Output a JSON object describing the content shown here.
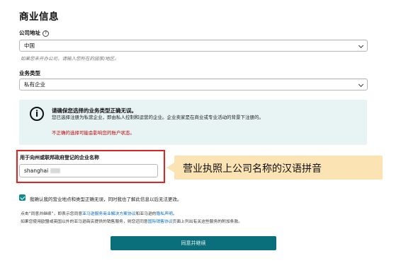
{
  "page": {
    "title": "商业信息"
  },
  "address": {
    "label": "公司地址",
    "help": "?",
    "value": "中国",
    "hint": "如果您未开办公司，请输入您所在的国家/地区。"
  },
  "business_type": {
    "label": "业务类型",
    "value": "私有企业"
  },
  "info": {
    "icon": "i",
    "title": "请确保您选择的业务类型正确无误。",
    "body": "您已选择注册为私营企业，即由私人控制和运营的企业。企业卖家是在商业或专业活动的背景下注册的。",
    "warning": "不正确的选择可能会影响您的账户状态。"
  },
  "company_name": {
    "label": "用于向州或联邦政府登记的企业名称",
    "value": "shanghai"
  },
  "callout": {
    "text": "营业执照上公司名称的汉语拼音"
  },
  "confirm": {
    "label": "我确认我的营业地点和类型正确无误，同时我也了解此信息以后无法更改。"
  },
  "legal": {
    "line1_pre": "点击“同意并继续”，即表示您同意",
    "line1_link1": "亚马逊服务商业解决方案协议",
    "line1_mid": "和亚马逊的",
    "line1_link2": "隐私声明",
    "line1_end": "。",
    "line2_pre": "如果您使用欧盟或英国以外的亚马逊商店提供的销售服务，则您还同意",
    "line2_link": "国际销售协议",
    "line2_end": "页面上列出有关这些服务的附加条款。"
  },
  "submit": {
    "label": "同意并继续"
  },
  "colors": {
    "accent": "#0a6f7a",
    "highlight": "#e32222",
    "callout": "#fbe3b3",
    "info_bg": "#e8f3f3"
  }
}
